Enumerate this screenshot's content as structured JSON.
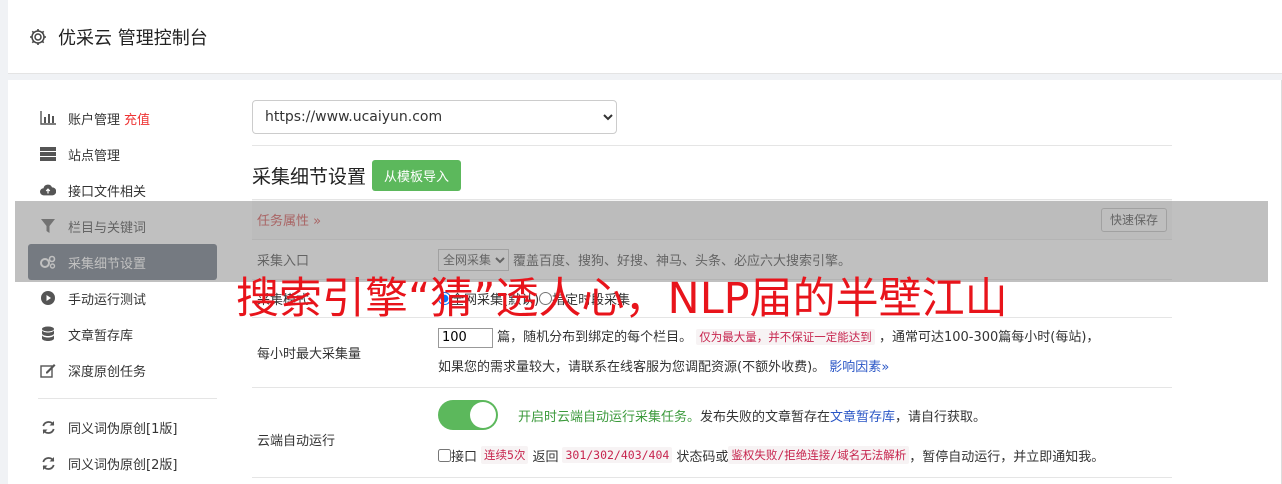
{
  "header": {
    "title": "优采云 管理控制台",
    "icon": "gear-icon"
  },
  "sidebar": {
    "items": [
      {
        "label": "账户管理",
        "extra": "充值",
        "icon": "bar-chart-icon"
      },
      {
        "label": "站点管理",
        "icon": "server-icon"
      },
      {
        "label": "接口文件相关",
        "icon": "cloud-upload-icon"
      },
      {
        "label": "栏目与关键词",
        "icon": "filter-icon"
      },
      {
        "label": "采集细节设置",
        "icon": "cogs-icon",
        "active": true
      },
      {
        "label": "手动运行测试",
        "icon": "play-circle-icon"
      },
      {
        "label": "文章暂存库",
        "icon": "database-icon"
      },
      {
        "label": "深度原创任务",
        "icon": "edit-icon"
      }
    ],
    "items2": [
      {
        "label": "同义词伪原创[1版]",
        "icon": "refresh-icon"
      },
      {
        "label": "同义词伪原创[2版]",
        "icon": "refresh-icon"
      }
    ]
  },
  "site_select": {
    "value": "https://www.ucaiyun.com"
  },
  "section": {
    "title": "采集细节设置",
    "import_button": "从模板导入"
  },
  "table": {
    "header": {
      "attr_label": "任务属性",
      "save_button": "快速保存"
    },
    "rows": {
      "entry": {
        "label": "采集入口",
        "select_value": "全网采集",
        "desc": "覆盖百度、搜狗、好搜、神马、头条、必应六大搜索引擎。"
      },
      "mode": {
        "label": "采集模式",
        "opt1": "全网采集(默认)",
        "opt2": "指定时段采集"
      },
      "max": {
        "label": "每小时最大采集量",
        "input_value": "100",
        "text1": "篇，随机分布到绑定的每个栏目。",
        "code1": "仅为最大量，并不保证一定能达到",
        "text2": "，通常可达100-300篇每小时(每站)，",
        "text3": "如果您的需求量较大，请联系在线客服为您调配资源(不额外收费)。",
        "link": "影响因素"
      },
      "auto": {
        "label": "云端自动运行",
        "green_text": "开启时云端自动运行采集任务。",
        "text1": "发布失败的文章暂存在",
        "link": "文章暂存库",
        "text2": "，请自行获取。",
        "cb_label": "接口",
        "code1": "连续5次",
        "text3": "返回",
        "code2": "301/302/403/404",
        "text4": "状态码或",
        "code3": "鉴权失败/拒绝连接/域名无法解析",
        "text5": "，暂停自动运行，并立即通知我。"
      }
    }
  },
  "overlay_text": "搜索引擎“猜”透人心，NLP届的半壁江山",
  "colors": {
    "accent_green": "#5cb85c",
    "active_sidebar": "#5a6474",
    "overlay_red": "#e8141b"
  }
}
